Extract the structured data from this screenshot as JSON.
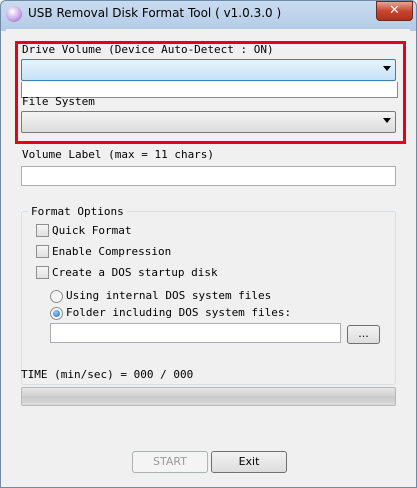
{
  "window": {
    "title": "USB Removal Disk Format Tool ( v1.0.3.0 )",
    "close_label": "✕"
  },
  "drive": {
    "label": "Drive Volume  (Device Auto-Detect : ON)",
    "value": ""
  },
  "filesystem": {
    "label": "File System",
    "value": ""
  },
  "volume_label": {
    "label": "Volume Label (max = 11 chars)",
    "value": ""
  },
  "format_options": {
    "title": "Format Options",
    "quick_format": "Quick Format",
    "enable_compression": "Enable Compression",
    "dos_startup": "Create a DOS startup disk",
    "radio_internal": "Using internal DOS system files",
    "radio_folder": "Folder including DOS system files:",
    "folder_path": "",
    "browse_label": "..."
  },
  "time": {
    "label": "TIME (min/sec) = 000 / 000"
  },
  "progress_fraction": 0,
  "buttons": {
    "start": "START",
    "exit": "Exit"
  },
  "colors": {
    "highlight_border": "#e3001b",
    "title_bar": "#b3cbe6"
  }
}
